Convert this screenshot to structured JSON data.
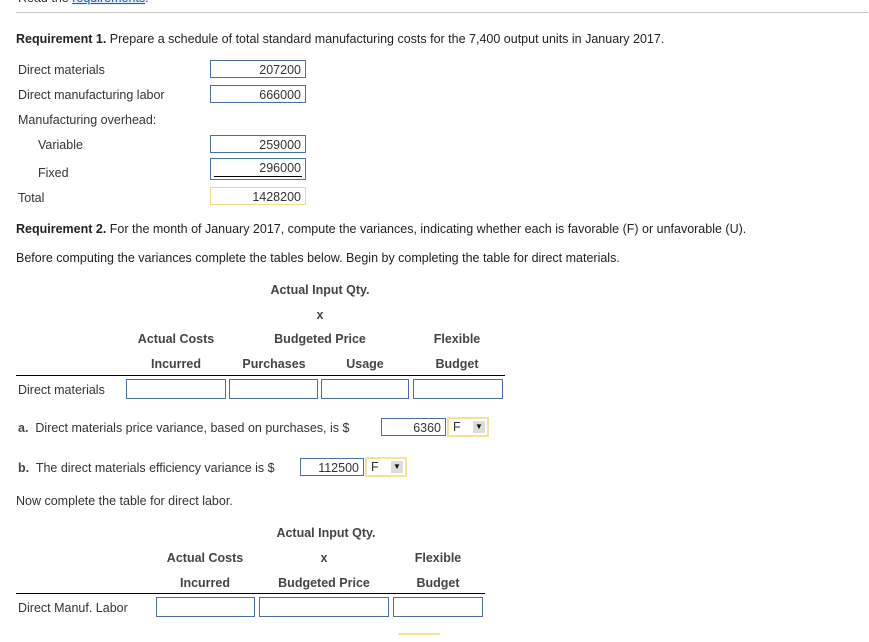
{
  "header": {
    "prefix": "Read the",
    "link": "requirements",
    "suffix": "."
  },
  "requirement1": {
    "label": "Requirement 1.",
    "text": "Prepare a schedule of total standard manufacturing costs for the 7,400 output units in January 2017.",
    "rows": [
      {
        "label": "Direct materials",
        "value": "207200"
      },
      {
        "label": "Direct manufacturing labor",
        "value": "666000"
      },
      {
        "label": "Manufacturing overhead:"
      },
      {
        "label": "Variable",
        "value": "259000"
      },
      {
        "label": "Fixed",
        "value": "296000"
      },
      {
        "label": "Total",
        "value": "1428200"
      }
    ]
  },
  "requirement2": {
    "label": "Requirement 2.",
    "text": "For the month of January 2017, compute the variances, indicating whether each is favorable (F) or unfavorable (U).",
    "instruction": "Before computing the variances complete the tables below. Begin by completing the table for direct materials.",
    "dm_table": {
      "headers": {
        "actual_input": "Actual Input Qty.",
        "x": "x",
        "actual_costs": "Actual Costs",
        "budgeted_price": "Budgeted Price",
        "flexible": "Flexible",
        "incurred": "Incurred",
        "purchases": "Purchases",
        "usage": "Usage",
        "budget": "Budget"
      },
      "row_label": "Direct materials",
      "values": [
        "",
        "",
        "",
        ""
      ]
    },
    "part_a": {
      "letter": "a.",
      "text": "Direct materials price variance, based on purchases, is $",
      "value": "6360",
      "selection": "F"
    },
    "part_b": {
      "letter": "b.",
      "text": "The direct materials efficiency variance is $",
      "value": "112500",
      "selection": "F"
    },
    "labor_instruction": "Now complete the table for direct labor.",
    "dl_table": {
      "headers": {
        "actual_input": "Actual Input Qty.",
        "actual_costs": "Actual Costs",
        "x": "x",
        "flexible": "Flexible",
        "incurred": "Incurred",
        "budgeted_price": "Budgeted Price",
        "budget": "Budget"
      },
      "row_label": "Direct Manuf. Labor",
      "values": [
        "",
        "",
        ""
      ]
    }
  },
  "icons": {
    "dropdown_arrow": "▼"
  }
}
